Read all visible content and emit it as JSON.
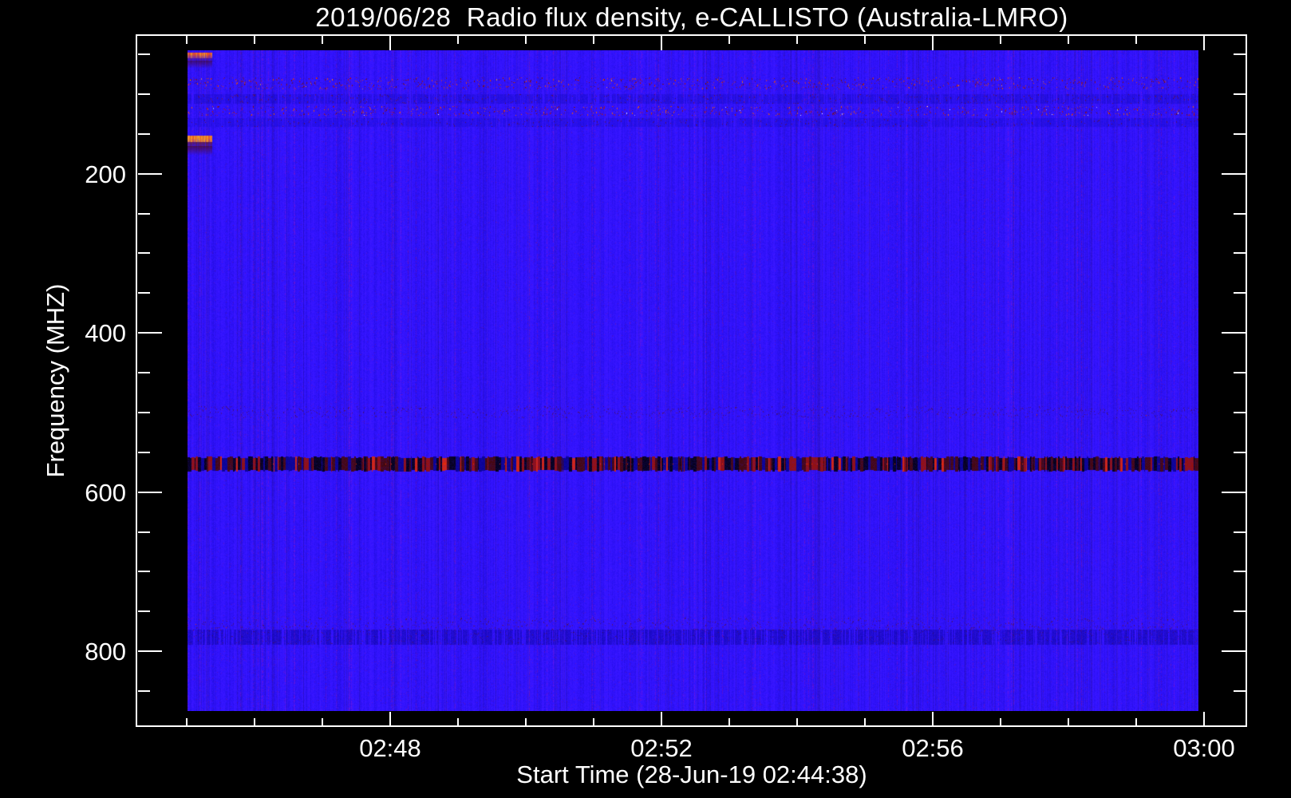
{
  "chart_data": {
    "type": "heatmap",
    "title": "2019/06/28  Radio flux density, e-CALLISTO (Australia-LMRO)",
    "xlabel": "Start Time (28-Jun-19 02:44:38)",
    "ylabel": "Frequency (MHZ)",
    "x_axis": {
      "start_time": "02:44:38",
      "end_time": "03:00",
      "major_tick_labels": [
        "02:48",
        "02:52",
        "02:56",
        "03:00"
      ],
      "major_tick_interval": "4 min",
      "minor_tick_interval": "1 min",
      "first_minor_tick": "02:45"
    },
    "y_axis": {
      "unit": "MHz",
      "range_mhz": [
        45,
        875
      ],
      "major_tick_labels": [
        "200",
        "400",
        "600",
        "800"
      ],
      "major_tick_values": [
        200,
        400,
        600,
        800
      ],
      "minor_tick_interval_mhz": 50,
      "direction": "increasing-downward"
    },
    "legend": "none",
    "grid": "off",
    "colors": {
      "figure_background": "#000000",
      "axis_and_text": "#ffffff",
      "quiet_background_blue": "#1e0cf0",
      "weak_rfi_dark_red": "#7c0f08",
      "medium_rfi_red": "#d81804",
      "strong_rfi_orange": "#ff8c14",
      "intense_rfi_yellow": "#ffe23c",
      "saturated_white": "#ffffff",
      "absorption_dark": "#05010e"
    },
    "rfi_bands": [
      {
        "name": "vhf-50mhz-burst-band",
        "freq_mhz": [
          48,
          58
        ],
        "style": "dashes",
        "strength": 0.95,
        "dash_group": 0,
        "colors": [
          "#d81204",
          "#ff5a0a",
          "#ff9616",
          "#ffd22a"
        ],
        "echo_mhz": [
          58,
          66
        ],
        "echo_color": "#6e0c06",
        "rare_accent": "#b4e428"
      },
      {
        "name": "speckle-85mhz",
        "freq_mhz": [
          79,
          93
        ],
        "style": "speckle",
        "density": 0.5,
        "colors": [
          "#b31205",
          "#7c0f08",
          "#e24410"
        ],
        "bright_rare": "#ffb020"
      },
      {
        "name": "dark-line-105mhz",
        "freq_mhz": [
          100,
          111
        ],
        "style": "darkline",
        "density": 0.3,
        "navy": "#0d07b4",
        "colors": [
          "#801004",
          "#5a0c10"
        ]
      },
      {
        "name": "speckle-120mhz",
        "freq_mhz": [
          115,
          126
        ],
        "style": "speckle",
        "density": 0.42,
        "colors": [
          "#c01505",
          "#801008",
          "#e85a10"
        ],
        "bright_rare": "#ffffff"
      },
      {
        "name": "dark-line-135mhz",
        "freq_mhz": [
          130,
          140
        ],
        "style": "darkline",
        "density": 0.22,
        "navy": "#1009c8",
        "colors": [
          "#6a0e08"
        ]
      },
      {
        "name": "fm-158mhz-burst-band",
        "freq_mhz": [
          152,
          165
        ],
        "style": "dashes",
        "strength": 1.2,
        "dash_group": 0,
        "colors": [
          "#e81804",
          "#ff6410",
          "#ffa018",
          "#ffe23c"
        ],
        "echo_mhz": [
          165,
          175
        ],
        "echo_color": "#7c1006",
        "rare_accent": "#b4e428"
      },
      {
        "name": "faint-speckle-500mhz",
        "freq_mhz": [
          492,
          506
        ],
        "style": "faint",
        "density": 0.62,
        "colors": [
          "#4c0d20",
          "#6a1018"
        ]
      },
      {
        "name": "dtv-565mhz-band",
        "freq_mhz": [
          556,
          572
        ],
        "style": "tv",
        "colors": [
          "#040112",
          "#470806",
          "#991106",
          "#e02806",
          "#0a038e"
        ],
        "weights": [
          0.3,
          0.24,
          0.16,
          0.07,
          0.23
        ],
        "bright_rare": "#ff3a08"
      },
      {
        "name": "faint-speckle-765mhz",
        "freq_mhz": [
          758,
          773
        ],
        "style": "faint",
        "density": 0.55,
        "colors": [
          "#55101c",
          "#6a1216"
        ]
      },
      {
        "name": "navy-780mhz-band",
        "freq_mhz": [
          773,
          791
        ],
        "style": "navy",
        "density": 0.7,
        "navy": "#0b049e",
        "colors": [
          "#5c0e14"
        ]
      }
    ]
  }
}
